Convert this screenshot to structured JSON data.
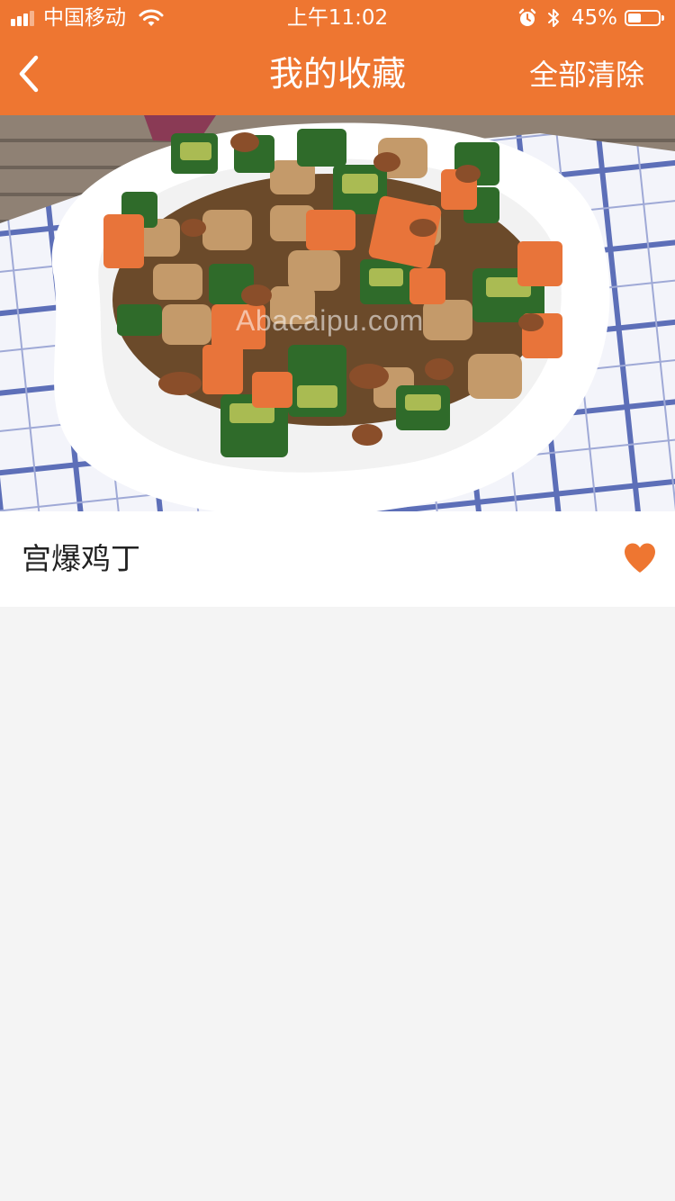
{
  "status_bar": {
    "carrier": "中国移动",
    "time": "上午11:02",
    "battery_percent": "45%",
    "battery_level": 0.45,
    "icons": [
      "signal-icon",
      "wifi-icon",
      "alarm-icon",
      "bluetooth-icon",
      "battery-icon"
    ]
  },
  "header": {
    "title": "我的收藏",
    "back_icon": "chevron-left-icon",
    "clear_all_label": "全部清除"
  },
  "favorites": [
    {
      "name": "宫爆鸡丁",
      "watermark": "Abacaipu.com",
      "favorite_icon": "heart-icon"
    }
  ],
  "colors": {
    "accent": "#ee7631",
    "background": "#f4f4f4",
    "card": "#ffffff"
  }
}
